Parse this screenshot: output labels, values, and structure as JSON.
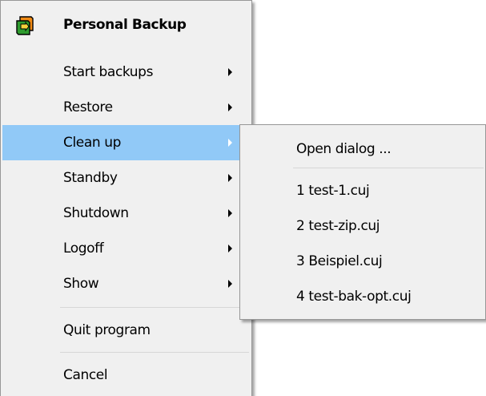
{
  "menu": {
    "header": {
      "icon": "personal-backup-app-icon",
      "title": "Personal Backup"
    },
    "items": [
      {
        "label": "Start backups",
        "submenu": true
      },
      {
        "label": "Restore",
        "submenu": true
      },
      {
        "label": "Clean up",
        "submenu": true,
        "highlighted": true
      },
      {
        "label": "Standby",
        "submenu": true
      },
      {
        "label": "Shutdown",
        "submenu": true
      },
      {
        "label": "Logoff",
        "submenu": true
      },
      {
        "label": "Show",
        "submenu": true
      },
      {
        "label": "Quit program",
        "submenu": false
      },
      {
        "label": "Cancel",
        "submenu": false
      }
    ]
  },
  "submenu": {
    "parent": "Clean up",
    "open_dialog_label": "Open dialog ...",
    "recent_files": [
      {
        "label": "1 test-1.cuj"
      },
      {
        "label": "2 test-zip.cuj"
      },
      {
        "label": "3 Beispiel.cuj"
      },
      {
        "label": "4 test-bak-opt.cuj"
      }
    ]
  },
  "colors": {
    "menu_background": "#f0f0f0",
    "highlight": "#91c9f7",
    "border": "#979797",
    "separator": "#d7d7d7",
    "icon_green": "#2e9b2e",
    "icon_orange": "#f08a14"
  }
}
